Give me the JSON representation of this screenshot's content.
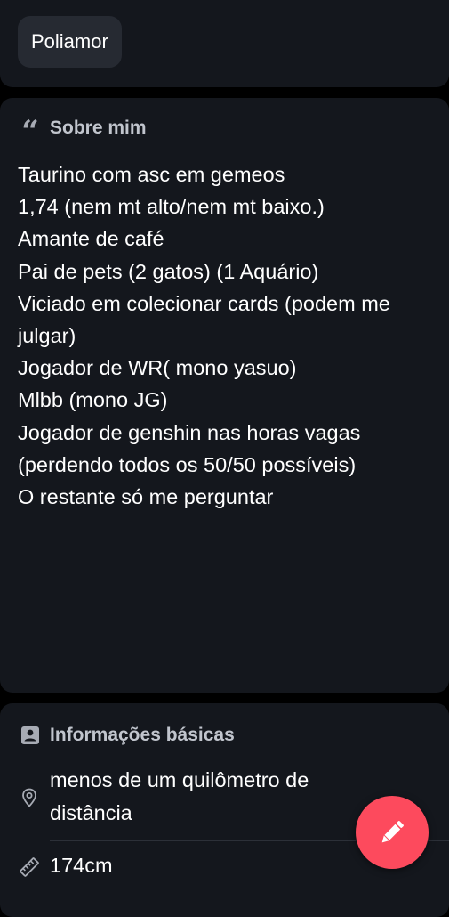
{
  "top_card": {
    "chip_label": "Poliamor"
  },
  "about": {
    "title": "Sobre mim",
    "icon": "quote-icon",
    "lines": [
      "Taurino com asc em gemeos",
      "1,74 (nem mt alto/nem mt baixo.)",
      "Amante de café",
      "Pai de pets (2 gatos) (1 Aquário)",
      "Viciado em colecionar cards (podem me julgar)",
      "Jogador de WR( mono yasuo)",
      "Mlbb (mono JG)",
      "Jogador de genshin nas horas vagas (perdendo todos os 50/50 possíveis)",
      "O restante só me perguntar"
    ]
  },
  "basic_info": {
    "title": "Informações básicas",
    "icon": "id-card-icon",
    "distance": "menos de um quilômetro de distância",
    "distance_icon": "location-pin-icon",
    "height": "174cm",
    "height_icon": "ruler-icon"
  },
  "fab": {
    "icon": "edit-pencil-icon",
    "color": "#fd4a5d"
  },
  "colors": {
    "background": "#000000",
    "card": "#14171d",
    "chip": "#262a32",
    "accent": "#fd4a5d",
    "muted_text": "#c1c5cd"
  }
}
